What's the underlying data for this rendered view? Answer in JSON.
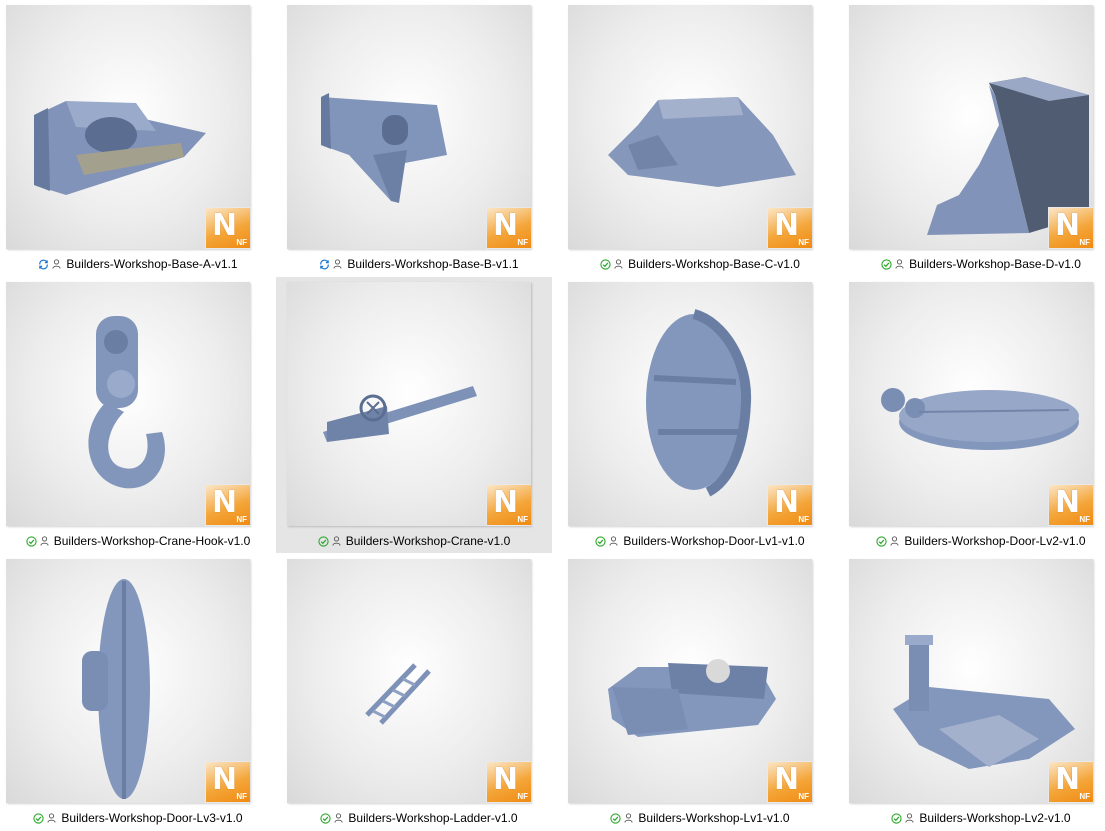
{
  "colors": {
    "synced_green": "#2ca82c",
    "syncing_blue": "#1f78d1",
    "model_blue": "#7f95bb",
    "selection": "#cce8ff"
  },
  "files": [
    {
      "name": "Builders-Workshop-Base-A-v1.1",
      "status": "syncing",
      "status_icon": "sync-icon",
      "badge": {
        "letter": "N",
        "sub": "NF"
      }
    },
    {
      "name": "Builders-Workshop-Base-B-v1.1",
      "status": "syncing",
      "status_icon": "sync-icon",
      "badge": {
        "letter": "N",
        "sub": "NF"
      }
    },
    {
      "name": "Builders-Workshop-Base-C-v1.0",
      "status": "available",
      "status_icon": "check-icon",
      "badge": {
        "letter": "N",
        "sub": "NF"
      }
    },
    {
      "name": "Builders-Workshop-Base-D-v1.0",
      "status": "available",
      "status_icon": "check-icon",
      "badge": {
        "letter": "N",
        "sub": "NF"
      }
    },
    {
      "name": "Builders-Workshop-Crane-Hook-v1.0",
      "status": "available",
      "status_icon": "check-icon",
      "badge": {
        "letter": "N",
        "sub": "NF"
      }
    },
    {
      "name": "Builders-Workshop-Crane-v1.0",
      "status": "available",
      "status_icon": "check-icon",
      "badge": {
        "letter": "N",
        "sub": "NF"
      },
      "hovered": true
    },
    {
      "name": "Builders-Workshop-Door-Lv1-v1.0",
      "status": "available",
      "status_icon": "check-icon",
      "badge": {
        "letter": "N",
        "sub": "NF"
      }
    },
    {
      "name": "Builders-Workshop-Door-Lv2-v1.0",
      "status": "available",
      "status_icon": "check-icon",
      "badge": {
        "letter": "N",
        "sub": "NF"
      }
    },
    {
      "name": "Builders-Workshop-Door-Lv3-v1.0",
      "status": "available",
      "status_icon": "check-icon",
      "badge": {
        "letter": "N",
        "sub": "NF"
      }
    },
    {
      "name": "Builders-Workshop-Ladder-v1.0",
      "status": "available",
      "status_icon": "check-icon",
      "badge": {
        "letter": "N",
        "sub": "NF"
      }
    },
    {
      "name": "Builders-Workshop-Lv1-v1.0",
      "status": "available",
      "status_icon": "check-icon",
      "badge": {
        "letter": "N",
        "sub": "NF"
      }
    },
    {
      "name": "Builders-Workshop-Lv2-v1.0",
      "status": "available",
      "status_icon": "check-icon",
      "badge": {
        "letter": "N",
        "sub": "NF"
      }
    }
  ]
}
